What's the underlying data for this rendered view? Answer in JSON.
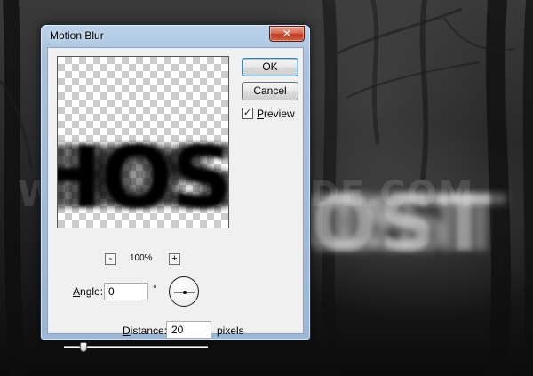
{
  "background": {
    "watermark": "WWW.PSD-DUDE.COM",
    "ghost_text": "OST"
  },
  "dialog": {
    "title": "Motion Blur",
    "close_glyph": "✕",
    "preview_image_text": "HOS",
    "ok_label": "OK",
    "cancel_label": "Cancel",
    "preview_checkbox": {
      "label_first": "P",
      "label_rest": "review",
      "checked": true,
      "check_glyph": "✓"
    },
    "zoom": {
      "minus": "-",
      "level": "100%",
      "plus": "+"
    },
    "angle": {
      "label_first": "A",
      "label_rest": "ngle:",
      "value": "0",
      "unit": "°",
      "dial_angle_deg": 0
    },
    "distance": {
      "label_first": "D",
      "label_rest": "istance:",
      "value": "20",
      "unit": "pixels"
    },
    "slider_position": 0.12
  },
  "colors": {
    "dialog_frame": "#a9c3e0",
    "client_bg": "#f0f0f0",
    "close_button": "#c0391f"
  }
}
